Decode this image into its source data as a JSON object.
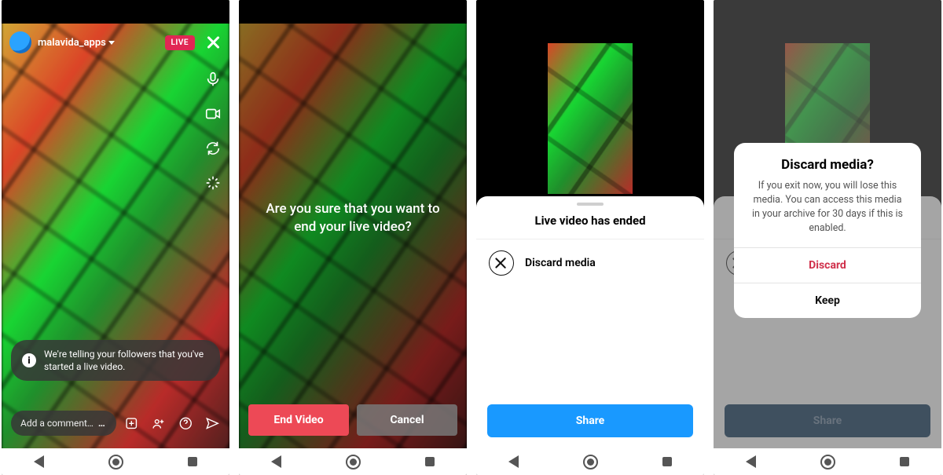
{
  "screen1": {
    "username": "malavida_apps",
    "live_badge": "LIVE",
    "toast": "We're telling your followers that you've started a live video.",
    "comment_placeholder": "Add a comment…"
  },
  "screen2": {
    "confirm": "Are you sure that you want to end your live video?",
    "end": "End Video",
    "cancel": "Cancel"
  },
  "screen3": {
    "title": "Live video has ended",
    "discard": "Discard media",
    "share": "Share"
  },
  "screen4": {
    "title": "Discard media?",
    "message": "If you exit now, you will lose this media. You can access this media in your archive for 30 days if this is enabled.",
    "discard": "Discard",
    "keep": "Keep",
    "share": "Share"
  }
}
